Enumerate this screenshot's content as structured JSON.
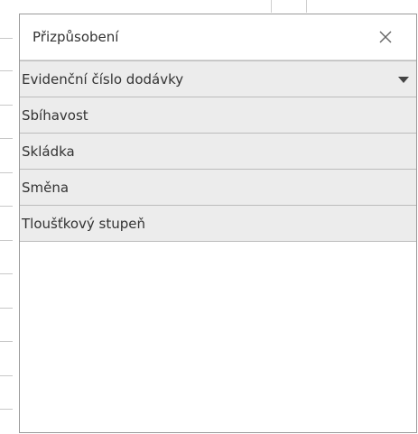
{
  "panel": {
    "title": "Přizpůsobení",
    "close_icon": "close-icon"
  },
  "fields": [
    {
      "label": "Evidenční číslo dodávky",
      "has_dropdown": true
    },
    {
      "label": "Sbíhavost"
    },
    {
      "label": "Skládka"
    },
    {
      "label": "Směna"
    },
    {
      "label": "Tloušťkový stupeň"
    }
  ]
}
